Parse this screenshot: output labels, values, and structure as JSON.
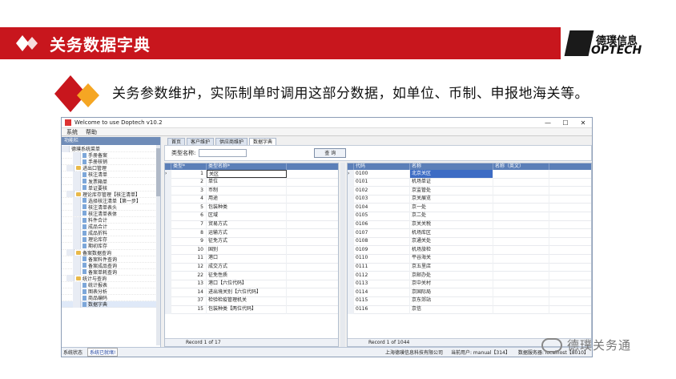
{
  "banner": {
    "title": "关务数据字典",
    "accent": "#c8161d"
  },
  "logo": {
    "top": "德璞信息",
    "bottom": "OPTECH",
    "mark": "D"
  },
  "subheading": "关务参数维护，实际制单时调用这部分数据，如单位、币制、申报地海关等。",
  "window": {
    "title": "Welcome to use Doptech v10.2",
    "controls": [
      "—",
      "☐",
      "✕"
    ],
    "menu": [
      "系统",
      "帮助"
    ],
    "left_header": "功能栏",
    "tree": [
      {
        "label": "德璞系统菜单",
        "type": "root"
      },
      {
        "label": "手册备案",
        "type": "doc"
      },
      {
        "label": "手册核销",
        "type": "doc"
      },
      {
        "label": "进出口管理",
        "type": "folder"
      },
      {
        "label": "核注清单",
        "type": "doc"
      },
      {
        "label": "发票箱单",
        "type": "doc"
      },
      {
        "label": "单证要核",
        "type": "doc"
      },
      {
        "label": "理论库存管理【核注清单】",
        "type": "folder"
      },
      {
        "label": "选择核注清单【第一步】",
        "type": "doc"
      },
      {
        "label": "核注清单表头",
        "type": "doc"
      },
      {
        "label": "核注清单表体",
        "type": "doc"
      },
      {
        "label": "料件合计",
        "type": "doc"
      },
      {
        "label": "成品合计",
        "type": "doc"
      },
      {
        "label": "成品折料",
        "type": "doc"
      },
      {
        "label": "理论库存",
        "type": "doc"
      },
      {
        "label": "期初库存",
        "type": "doc"
      },
      {
        "label": "备案数据查询",
        "type": "folder"
      },
      {
        "label": "备案料件查询",
        "type": "doc"
      },
      {
        "label": "备案成品查询",
        "type": "doc"
      },
      {
        "label": "备案单耗查询",
        "type": "doc"
      },
      {
        "label": "统计与查询",
        "type": "folder"
      },
      {
        "label": "统计报表",
        "type": "doc"
      },
      {
        "label": "图表分析",
        "type": "doc"
      },
      {
        "label": "商品编码",
        "type": "doc"
      },
      {
        "label": "数据字典",
        "type": "doc"
      }
    ],
    "tabs": [
      "首页",
      "客户维护",
      "供应商维护",
      "数据字典"
    ],
    "search": {
      "label": "类型名称:",
      "value": "",
      "button": "查 询"
    },
    "grid1": {
      "headers": [
        "类型*",
        "类型名称*"
      ],
      "rows": [
        [
          "1",
          "关区"
        ],
        [
          "2",
          "单位"
        ],
        [
          "3",
          "币制"
        ],
        [
          "4",
          "用途"
        ],
        [
          "5",
          "包装种类"
        ],
        [
          "6",
          "区域"
        ],
        [
          "7",
          "贸易方式"
        ],
        [
          "8",
          "运输方式"
        ],
        [
          "9",
          "征免方式"
        ],
        [
          "10",
          "国别"
        ],
        [
          "11",
          "港口"
        ],
        [
          "12",
          "成交方式"
        ],
        [
          "22",
          "征免性质"
        ],
        [
          "13",
          "港口【六位代码】"
        ],
        [
          "14",
          "进出境关别【六位代码】"
        ],
        [
          "37",
          "检验检疫管理机关"
        ],
        [
          "15",
          "包装种类【两位代码】"
        ]
      ],
      "footer": "Record 1 of 17"
    },
    "grid2": {
      "headers": [
        "代码",
        "名称",
        "名称（英文）"
      ],
      "rows": [
        [
          "0100",
          "北京关区"
        ],
        [
          "0101",
          "机场单证"
        ],
        [
          "0102",
          "京监管处"
        ],
        [
          "0103",
          "京关展览"
        ],
        [
          "0104",
          "京一处"
        ],
        [
          "0105",
          "京二处"
        ],
        [
          "0106",
          "京关关税"
        ],
        [
          "0107",
          "机场库区"
        ],
        [
          "0108",
          "京通关处"
        ],
        [
          "0109",
          "机场旅检"
        ],
        [
          "0110",
          "平谷海关"
        ],
        [
          "0111",
          "京五里店"
        ],
        [
          "0112",
          "京邮办处"
        ],
        [
          "0113",
          "京中关村"
        ],
        [
          "0114",
          "京国际局"
        ],
        [
          "0115",
          "京东郊站"
        ],
        [
          "0116",
          "京信"
        ]
      ],
      "footer": "Record 1 of 1044"
    },
    "status": {
      "label": "系统状态",
      "state": "系统已就绪!",
      "company": "上海德璞信息科技有限公司",
      "user": "当前用户:  manual【314】",
      "server": "数据服务器:  localhost【8010】"
    }
  },
  "watermark": "德璞关务通"
}
